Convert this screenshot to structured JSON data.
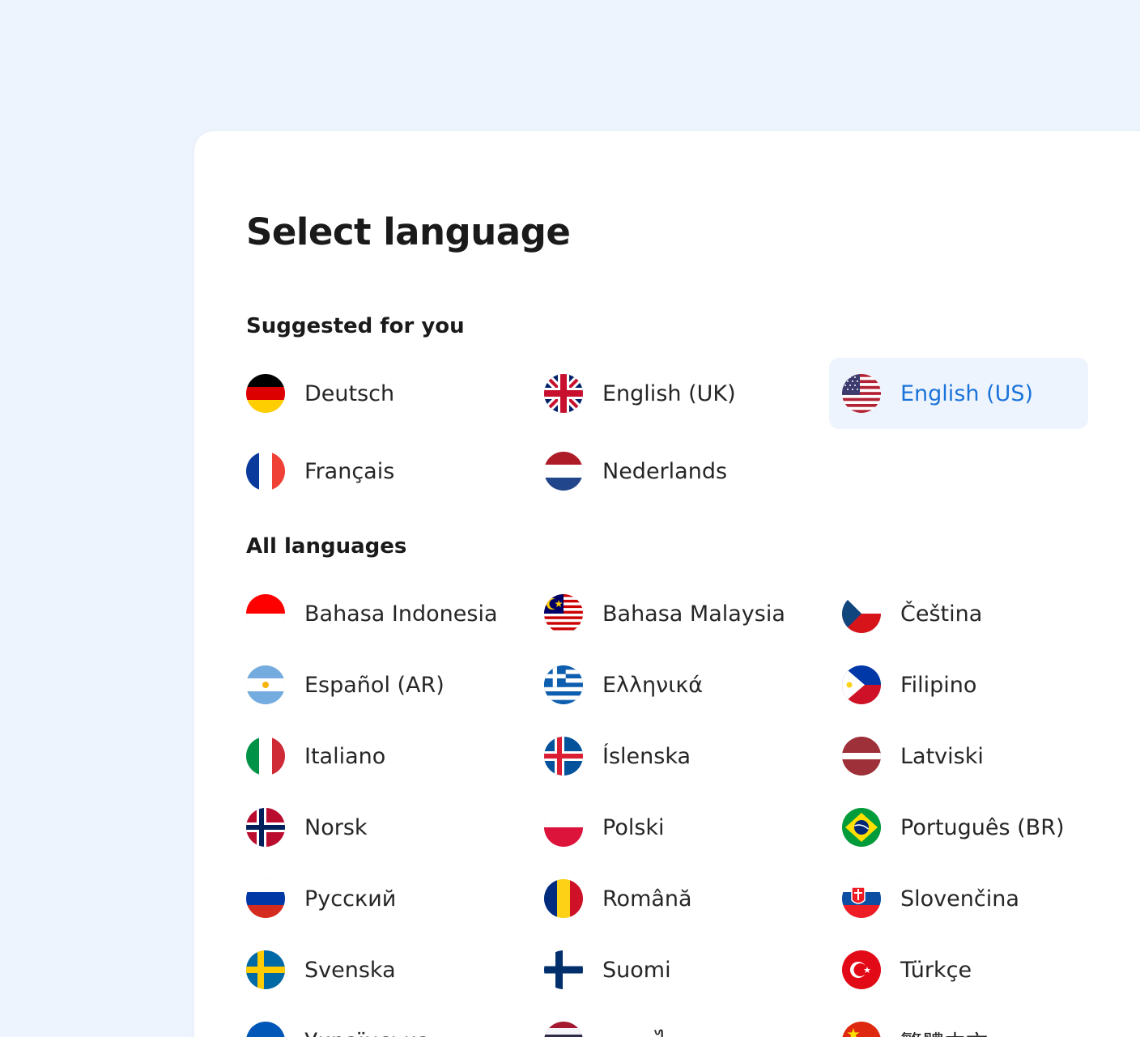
{
  "title": "Select language",
  "sections": {
    "suggested": "Suggested for you",
    "all": "All languages"
  },
  "suggested": [
    {
      "label": "Deutsch",
      "flag": "germany-flag-icon"
    },
    {
      "label": "English (UK)",
      "flag": "uk-flag-icon"
    },
    {
      "label": "English (US)",
      "flag": "us-flag-icon",
      "selected": true
    },
    {
      "label": "Français",
      "flag": "france-flag-icon"
    },
    {
      "label": "Nederlands",
      "flag": "netherlands-flag-icon"
    }
  ],
  "all": [
    {
      "label": "Bahasa Indonesia",
      "flag": "indonesia-flag-icon"
    },
    {
      "label": "Bahasa Malaysia",
      "flag": "malaysia-flag-icon"
    },
    {
      "label": "Čeština",
      "flag": "czech-flag-icon"
    },
    {
      "label": "Español (AR)",
      "flag": "argentina-flag-icon"
    },
    {
      "label": "Ελληνικά",
      "flag": "greece-flag-icon"
    },
    {
      "label": "Filipino",
      "flag": "philippines-flag-icon"
    },
    {
      "label": "Italiano",
      "flag": "italy-flag-icon"
    },
    {
      "label": "Íslenska",
      "flag": "iceland-flag-icon"
    },
    {
      "label": "Latviski",
      "flag": "latvia-flag-icon"
    },
    {
      "label": "Norsk",
      "flag": "norway-flag-icon"
    },
    {
      "label": "Polski",
      "flag": "poland-flag-icon"
    },
    {
      "label": "Português (BR)",
      "flag": "brazil-flag-icon"
    },
    {
      "label": "Русский",
      "flag": "russia-flag-icon"
    },
    {
      "label": "Română",
      "flag": "romania-flag-icon"
    },
    {
      "label": "Slovenčina",
      "flag": "slovakia-flag-icon"
    },
    {
      "label": "Svenska",
      "flag": "sweden-flag-icon"
    },
    {
      "label": "Suomi",
      "flag": "finland-flag-icon"
    },
    {
      "label": "Türkçe",
      "flag": "turkey-flag-icon"
    },
    {
      "label": "Українська",
      "flag": "ukraine-flag-icon"
    },
    {
      "label": "ภาษาไทย",
      "flag": "thailand-flag-icon"
    },
    {
      "label": "繁體中文",
      "flag": "china-flag-icon"
    }
  ],
  "colors": {
    "page_background": "#eef4fd",
    "panel_background": "#ffffff",
    "selected_background": "#eef4fd",
    "selected_text": "#1a73d9",
    "text": "#262626"
  }
}
